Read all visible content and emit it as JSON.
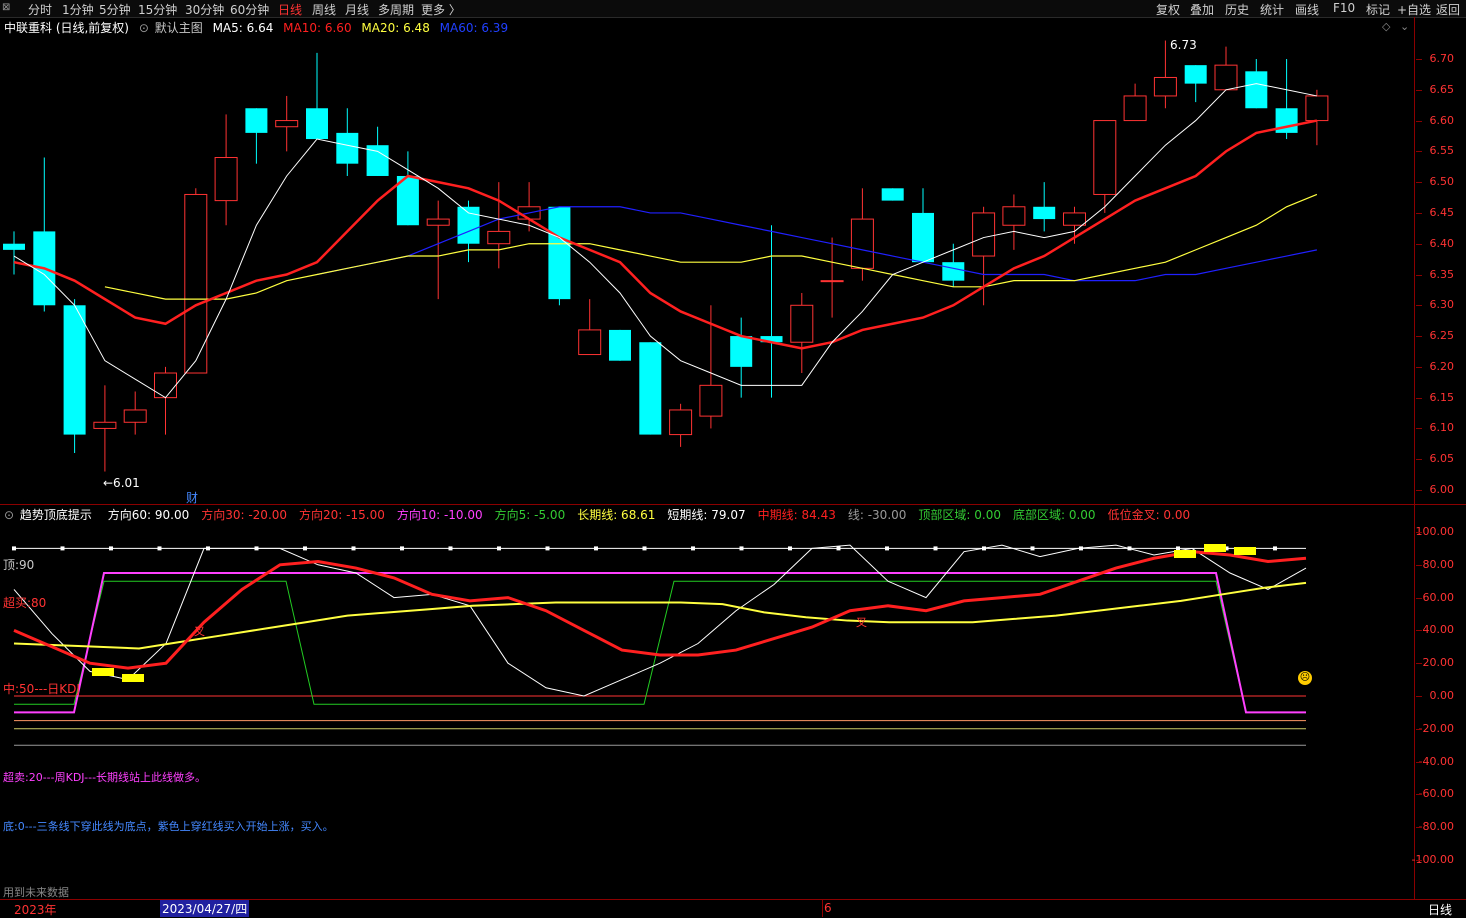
{
  "toolbar": {
    "left_items": [
      "分时",
      "1分钟",
      "5分钟",
      "15分钟",
      "30分钟",
      "60分钟",
      "日线",
      "周线",
      "月线",
      "多周期",
      "更多 〉"
    ],
    "active_item": "日线",
    "right_items": [
      "复权",
      "叠加",
      "历史",
      "统计",
      "画线",
      "F10",
      "标记",
      "+自选",
      "返回"
    ]
  },
  "main_info": {
    "stock": "中联重科 (日线,前复权)",
    "template": "默认主图",
    "ma5": "MA5: 6.64",
    "ma10": "MA10: 6.60",
    "ma20": "MA20: 6.48",
    "ma60": "MA60: 6.39"
  },
  "colors": {
    "up": "#ff3333",
    "down": "#00ffff",
    "ma5": "#ffffff",
    "ma10": "#ff2020",
    "ma20": "#ffff40",
    "ma60": "#2020ff",
    "axis": "#ff3333",
    "frame": "#8b0000"
  },
  "price_axis": [
    "6.70",
    "6.65",
    "6.60",
    "6.55",
    "6.50",
    "6.45",
    "6.40",
    "6.35",
    "6.30",
    "6.25",
    "6.20",
    "6.15",
    "6.10",
    "6.05",
    "6.00"
  ],
  "high_label": "6.73",
  "low_label": "←6.01",
  "finance_marker": "财",
  "indicator_info": {
    "name": "趋势顶底提示",
    "items": [
      {
        "text": "方向60: 90.00",
        "color": "#ffffff"
      },
      {
        "text": "方向30: -20.00",
        "color": "#ff3333"
      },
      {
        "text": "方向20: -15.00",
        "color": "#ff3333"
      },
      {
        "text": "方向10: -10.00",
        "color": "#ff40ff"
      },
      {
        "text": "方向5: -5.00",
        "color": "#33cc33"
      },
      {
        "text": "长期线: 68.61",
        "color": "#ffff40"
      },
      {
        "text": "短期线: 79.07",
        "color": "#ffffff"
      },
      {
        "text": "中期线: 84.43",
        "color": "#ff2020"
      },
      {
        "text": "线: -30.00",
        "color": "#999999"
      },
      {
        "text": "顶部区域: 0.00",
        "color": "#33cc33"
      },
      {
        "text": "底部区域: 0.00",
        "color": "#33cc33"
      },
      {
        "text": "低位金叉: 0.00",
        "color": "#ff3333"
      }
    ]
  },
  "indicator_axis": [
    "100.00",
    "80.00",
    "60.00",
    "40.00",
    "20.00",
    "0.00",
    "-20.00",
    "-40.00",
    "-60.00",
    "-80.00",
    "-100.00"
  ],
  "indicator_labels": {
    "top": "顶:90",
    "overbought": "超买:80",
    "middle": "中:50---日KDJ",
    "oversold": "超卖:20---周KDJ---长期线站上此线做多。",
    "bottom": "底:0---三条线下穿此线为底点，紫色上穿红线买入开始上涨，买入。",
    "future": "用到未来数据",
    "cross1": "叉",
    "cross2": "叉"
  },
  "bottom_bar": {
    "year": "2023年",
    "date": "2023/04/27/四",
    "month": "6",
    "period": "日线"
  },
  "chart_data": {
    "type": "candlestick",
    "candles": [
      {
        "o": 6.4,
        "c": 6.39,
        "h": 6.42,
        "l": 6.35
      },
      {
        "o": 6.42,
        "c": 6.3,
        "h": 6.54,
        "l": 6.29
      },
      {
        "o": 6.3,
        "c": 6.09,
        "h": 6.31,
        "l": 6.06
      },
      {
        "o": 6.1,
        "c": 6.11,
        "h": 6.17,
        "l": 6.03
      },
      {
        "o": 6.11,
        "c": 6.13,
        "h": 6.16,
        "l": 6.09
      },
      {
        "o": 6.15,
        "c": 6.19,
        "h": 6.2,
        "l": 6.09
      },
      {
        "o": 6.19,
        "c": 6.48,
        "h": 6.49,
        "l": 6.19
      },
      {
        "o": 6.47,
        "c": 6.54,
        "h": 6.61,
        "l": 6.43
      },
      {
        "o": 6.62,
        "c": 6.58,
        "h": 6.62,
        "l": 6.53
      },
      {
        "o": 6.59,
        "c": 6.6,
        "h": 6.64,
        "l": 6.55
      },
      {
        "o": 6.62,
        "c": 6.57,
        "h": 6.71,
        "l": 6.57
      },
      {
        "o": 6.58,
        "c": 6.53,
        "h": 6.62,
        "l": 6.51
      },
      {
        "o": 6.56,
        "c": 6.51,
        "h": 6.59,
        "l": 6.51
      },
      {
        "o": 6.51,
        "c": 6.43,
        "h": 6.55,
        "l": 6.43
      },
      {
        "o": 6.43,
        "c": 6.44,
        "h": 6.47,
        "l": 6.31
      },
      {
        "o": 6.46,
        "c": 6.4,
        "h": 6.47,
        "l": 6.37
      },
      {
        "o": 6.4,
        "c": 6.42,
        "h": 6.5,
        "l": 6.36
      },
      {
        "o": 6.44,
        "c": 6.46,
        "h": 6.5,
        "l": 6.42
      },
      {
        "o": 6.46,
        "c": 6.31,
        "h": 6.46,
        "l": 6.3
      },
      {
        "o": 6.22,
        "c": 6.26,
        "h": 6.31,
        "l": 6.22
      },
      {
        "o": 6.26,
        "c": 6.21,
        "h": 6.26,
        "l": 6.21
      },
      {
        "o": 6.24,
        "c": 6.09,
        "h": 6.24,
        "l": 6.09
      },
      {
        "o": 6.09,
        "c": 6.13,
        "h": 6.14,
        "l": 6.07
      },
      {
        "o": 6.12,
        "c": 6.17,
        "h": 6.3,
        "l": 6.1
      },
      {
        "o": 6.25,
        "c": 6.2,
        "h": 6.28,
        "l": 6.15
      },
      {
        "o": 6.25,
        "c": 6.24,
        "h": 6.43,
        "l": 6.15
      },
      {
        "o": 6.24,
        "c": 6.3,
        "h": 6.32,
        "l": 6.19
      },
      {
        "o": 6.34,
        "c": 6.34,
        "h": 6.41,
        "l": 6.28
      },
      {
        "o": 6.36,
        "c": 6.44,
        "h": 6.49,
        "l": 6.34
      },
      {
        "o": 6.49,
        "c": 6.47,
        "h": 6.49,
        "l": 6.47
      },
      {
        "o": 6.45,
        "c": 6.37,
        "h": 6.49,
        "l": 6.37
      },
      {
        "o": 6.37,
        "c": 6.34,
        "h": 6.4,
        "l": 6.33
      },
      {
        "o": 6.38,
        "c": 6.45,
        "h": 6.46,
        "l": 6.3
      },
      {
        "o": 6.43,
        "c": 6.46,
        "h": 6.48,
        "l": 6.39
      },
      {
        "o": 6.46,
        "c": 6.44,
        "h": 6.5,
        "l": 6.42
      },
      {
        "o": 6.43,
        "c": 6.45,
        "h": 6.46,
        "l": 6.4
      },
      {
        "o": 6.48,
        "c": 6.6,
        "h": 6.6,
        "l": 6.45
      },
      {
        "o": 6.6,
        "c": 6.64,
        "h": 6.66,
        "l": 6.6
      },
      {
        "o": 6.64,
        "c": 6.67,
        "h": 6.73,
        "l": 6.62
      },
      {
        "o": 6.69,
        "c": 6.66,
        "h": 6.69,
        "l": 6.63
      },
      {
        "o": 6.65,
        "c": 6.69,
        "h": 6.72,
        "l": 6.65
      },
      {
        "o": 6.68,
        "c": 6.62,
        "h": 6.7,
        "l": 6.62
      },
      {
        "o": 6.62,
        "c": 6.58,
        "h": 6.7,
        "l": 6.57
      },
      {
        "o": 6.6,
        "c": 6.64,
        "h": 6.65,
        "l": 6.56
      }
    ],
    "ma5": [
      6.38,
      6.35,
      6.3,
      6.21,
      6.18,
      6.15,
      6.21,
      6.31,
      6.43,
      6.51,
      6.57,
      6.56,
      6.55,
      6.52,
      6.49,
      6.45,
      6.44,
      6.43,
      6.41,
      6.37,
      6.32,
      6.25,
      6.21,
      6.19,
      6.17,
      6.17,
      6.17,
      6.24,
      6.29,
      6.35,
      6.37,
      6.39,
      6.41,
      6.42,
      6.41,
      6.42,
      6.46,
      6.51,
      6.56,
      6.6,
      6.65,
      6.66,
      6.65,
      6.64
    ],
    "ma10": [
      6.37,
      6.36,
      6.34,
      6.31,
      6.28,
      6.27,
      6.3,
      6.32,
      6.34,
      6.35,
      6.37,
      6.42,
      6.47,
      6.51,
      6.5,
      6.49,
      6.47,
      6.44,
      6.41,
      6.39,
      6.37,
      6.32,
      6.29,
      6.27,
      6.25,
      6.24,
      6.23,
      6.24,
      6.26,
      6.27,
      6.28,
      6.3,
      6.33,
      6.36,
      6.38,
      6.41,
      6.44,
      6.47,
      6.49,
      6.51,
      6.55,
      6.58,
      6.59,
      6.6
    ],
    "ma20": [
      6.33,
      6.32,
      6.31,
      6.31,
      6.31,
      6.32,
      6.34,
      6.35,
      6.36,
      6.37,
      6.38,
      6.38,
      6.39,
      6.39,
      6.4,
      6.4,
      6.4,
      6.39,
      6.38,
      6.37,
      6.37,
      6.37,
      6.38,
      6.38,
      6.37,
      6.36,
      6.35,
      6.34,
      6.33,
      6.33,
      6.34,
      6.34,
      6.34,
      6.35,
      6.36,
      6.37,
      6.39,
      6.41,
      6.43,
      6.46,
      6.48
    ],
    "ma60": [
      6.35,
      6.36,
      6.37,
      6.38,
      6.4,
      6.42,
      6.44,
      6.45,
      6.46,
      6.46,
      6.46,
      6.45,
      6.45,
      6.44,
      6.43,
      6.42,
      6.41,
      6.4,
      6.39,
      6.38,
      6.37,
      6.36,
      6.35,
      6.35,
      6.35,
      6.34,
      6.34,
      6.34,
      6.35,
      6.35,
      6.36,
      6.37,
      6.38,
      6.39
    ],
    "indicator": {
      "short": [
        65,
        38,
        15,
        10,
        32,
        90,
        90,
        90,
        80,
        75,
        60,
        62,
        55,
        20,
        5,
        0,
        10,
        20,
        32,
        52,
        68,
        90,
        92,
        70,
        60,
        88,
        92,
        85,
        90,
        92,
        86,
        90,
        75,
        65,
        78
      ],
      "mid": [
        40,
        30,
        20,
        17,
        20,
        45,
        65,
        80,
        82,
        78,
        72,
        62,
        58,
        60,
        52,
        40,
        28,
        25,
        25,
        28,
        35,
        42,
        52,
        55,
        52,
        58,
        60,
        62,
        70,
        78,
        84,
        88,
        86,
        82,
        84
      ],
      "long": [
        32,
        31,
        30,
        29,
        33,
        37,
        41,
        45,
        49,
        51,
        53,
        55,
        56,
        57,
        57,
        57,
        57,
        56,
        51,
        48,
        46,
        45,
        45,
        45,
        47,
        49,
        52,
        55,
        58,
        62,
        66,
        69
      ],
      "purple": [
        -10,
        75,
        75,
        75,
        75,
        75,
        75,
        75,
        75,
        75,
        75,
        75,
        75,
        75,
        75,
        75,
        75,
        75,
        75,
        75,
        75,
        75,
        75,
        75,
        75,
        75,
        75,
        -10
      ],
      "green": [
        -5,
        70,
        70,
        70,
        -5,
        -5,
        -5,
        -5,
        -5,
        70,
        70,
        70,
        70,
        70,
        70,
        70,
        70,
        70,
        70,
        70,
        -5
      ]
    }
  }
}
